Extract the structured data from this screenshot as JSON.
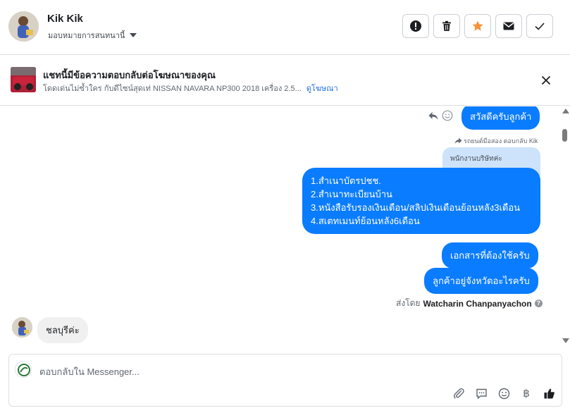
{
  "header": {
    "contact_name": "Kik Kik",
    "assign_label": "มอบหมายการสนทนานี้",
    "actions": [
      {
        "name": "mark-spam-button",
        "icon": "alert-icon"
      },
      {
        "name": "delete-button",
        "icon": "trash-icon"
      },
      {
        "name": "star-button",
        "icon": "star-icon"
      },
      {
        "name": "mark-unread-button",
        "icon": "envelope-icon"
      },
      {
        "name": "mark-done-button",
        "icon": "check-icon"
      }
    ],
    "star_color": "#f7923a"
  },
  "ad_banner": {
    "title": "แชทนี้มีข้อความตอบกลับต่อโฆษณาของคุณ",
    "subtitle": "โดดเด่นไม่ซ้ำใคร กับดีไซน์สุดเท่ NISSAN NAVARA NP300 2018 เครื่อง 2.5...",
    "link_label": "ดูโฆษณา"
  },
  "messages": {
    "greeting": "สวัสดีครับลูกค้า",
    "reply_note": "รถยนต์มือสอง ตอบกลับ Kik",
    "quoted_text": "พนักงานบริษัทค่ะ",
    "documents": [
      "1.สำเนาบัตรปชช.",
      "2.สำเนาทะเบียนบ้าน",
      "3.หนังสือรับรองเงินเดือน/สลิปเงินเดือนย้อนหลัง3เดือน",
      "4.สเตทเมนท์ย้อนหลัง6เดือน"
    ],
    "docs_needed": "เอกสารที่ต้องใช้ครับ",
    "province_question": "ลูกค้าอยู่จังหวัดอะไรครับ",
    "sent_by_label": "ส่งโดย",
    "sent_by_name": "Watcharin Chanpanyachon",
    "customer_reply": "ชลบุรีค่ะ",
    "bubble_color": "#0a7cff"
  },
  "composer": {
    "placeholder": "ตอบกลับใน Messenger...",
    "tools": [
      "attach-icon",
      "saved-reply-icon",
      "emoji-icon",
      "baht-icon",
      "thumbs-up-icon"
    ]
  }
}
